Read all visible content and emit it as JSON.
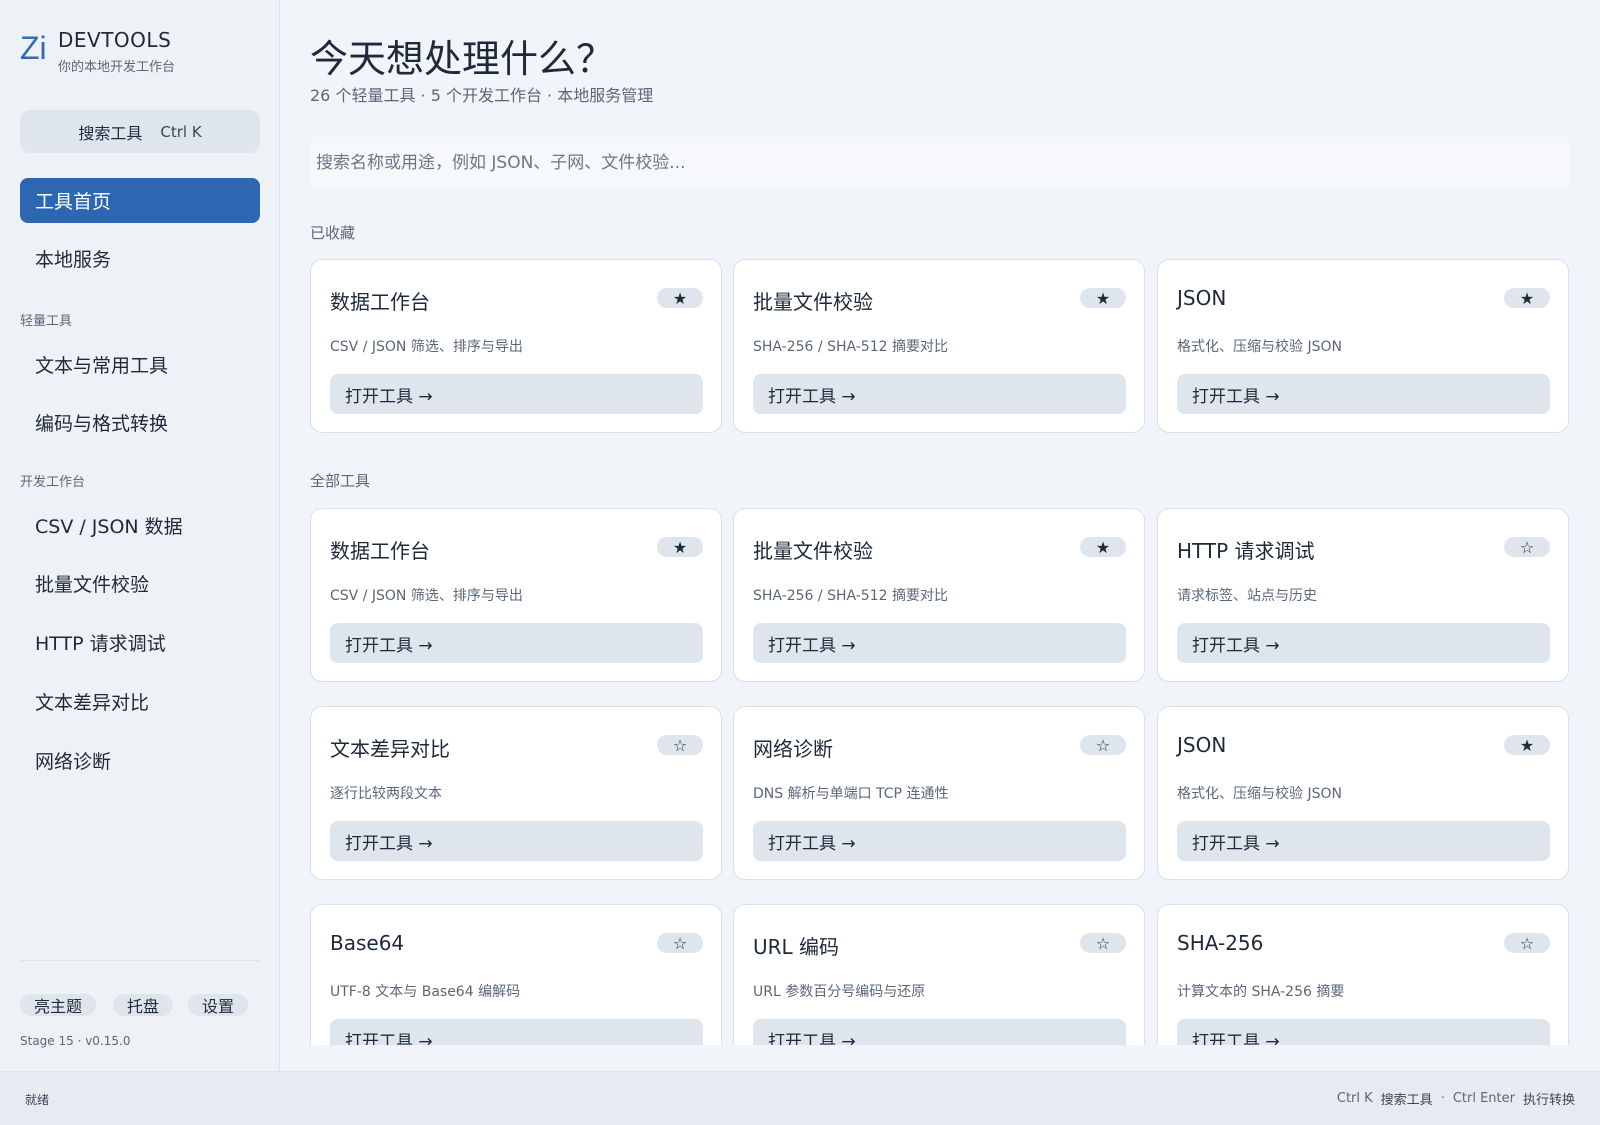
{
  "brand": {
    "logo": "Zi",
    "title": "DEVTOOLS",
    "subtitle": "你的本地开发工作台"
  },
  "search_tool": {
    "label": "搜索工具",
    "shortcut": "Ctrl K"
  },
  "nav": {
    "home": "工具首页",
    "services": "本地服务",
    "group_light": "轻量工具",
    "text_tools": "文本与常用工具",
    "encode_tools": "编码与格式转换",
    "group_dev": "开发工作台",
    "csv_json": "CSV / JSON 数据",
    "batch_verify": "批量文件校验",
    "http_debug": "HTTP 请求调试",
    "text_diff": "文本差异对比",
    "net_diag": "网络诊断"
  },
  "footer": {
    "theme": "亮主题",
    "tray": "托盘",
    "settings": "设置",
    "version": "Stage 15 · v0.15.0"
  },
  "status": {
    "left": "就绪",
    "k1": "Ctrl K",
    "a1": "搜索工具",
    "sep": "·",
    "k2": "Ctrl Enter",
    "a2": "执行转换"
  },
  "header": {
    "title": "今天想处理什么？",
    "subtitle": "26 个轻量工具 · 5 个开发工作台 · 本地服务管理",
    "search_placeholder": "搜索名称或用途，例如 JSON、子网、文件校验..."
  },
  "sections": {
    "favorites": "已收藏",
    "all": "全部工具"
  },
  "open_label": "打开工具 →",
  "icons": {
    "star_filled": "★",
    "star_outline": "☆"
  },
  "favorites": [
    {
      "title": "数据工作台",
      "desc": "CSV / JSON 筛选、排序与导出",
      "starred": true
    },
    {
      "title": "批量文件校验",
      "desc": "SHA-256 / SHA-512 摘要对比",
      "starred": true
    },
    {
      "title": "JSON",
      "desc": "格式化、压缩与校验 JSON",
      "starred": true
    }
  ],
  "all_tools": [
    {
      "title": "数据工作台",
      "desc": "CSV / JSON 筛选、排序与导出",
      "starred": true
    },
    {
      "title": "批量文件校验",
      "desc": "SHA-256 / SHA-512 摘要对比",
      "starred": true
    },
    {
      "title": "HTTP 请求调试",
      "desc": "请求标签、站点与历史",
      "starred": false
    },
    {
      "title": "文本差异对比",
      "desc": "逐行比较两段文本",
      "starred": false
    },
    {
      "title": "网络诊断",
      "desc": "DNS 解析与单端口 TCP 连通性",
      "starred": false
    },
    {
      "title": "JSON",
      "desc": "格式化、压缩与校验 JSON",
      "starred": true
    },
    {
      "title": "Base64",
      "desc": "UTF-8 文本与 Base64 编解码",
      "starred": false
    },
    {
      "title": "URL 编码",
      "desc": "URL 参数百分号编码与还原",
      "starred": false
    },
    {
      "title": "SHA-256",
      "desc": "计算文本的 SHA-256 摘要",
      "starred": false
    }
  ]
}
